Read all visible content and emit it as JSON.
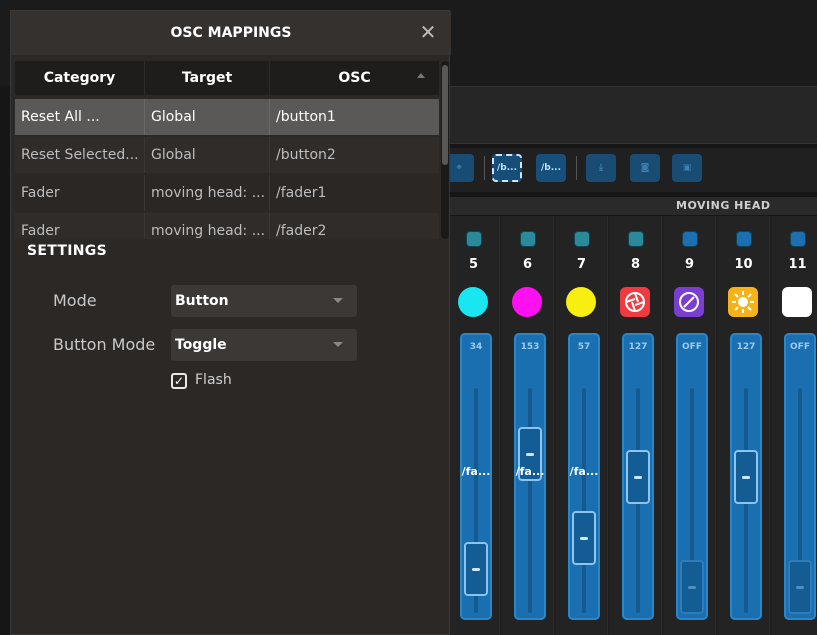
{
  "dialog": {
    "title": "OSC MAPPINGS",
    "close_glyph": "✕"
  },
  "table": {
    "headers": [
      "Category",
      "Target",
      "OSC"
    ],
    "rows": [
      {
        "category": "Reset All ...",
        "target": "Global",
        "osc": "/button1",
        "selected": true
      },
      {
        "category": "Reset Selected...",
        "target": "Global",
        "osc": "/button2",
        "selected": false
      },
      {
        "category": "Fader",
        "target": "moving head: ...",
        "osc": "/fader1",
        "selected": false
      },
      {
        "category": "Fader",
        "target": "moving head: ...",
        "osc": "/fader2",
        "selected": false
      }
    ]
  },
  "settings": {
    "title": "SETTINGS",
    "mode_label": "Mode",
    "mode_value": "Button",
    "button_mode_label": "Button Mode",
    "button_mode_value": "Toggle",
    "flash_label": "Flash",
    "flash_checked": true,
    "check_glyph": "✓"
  },
  "toolbar": {
    "buttons": [
      {
        "label": "",
        "icon": "target-icon",
        "state": "dim"
      },
      {
        "label": "/b...",
        "icon": "osc-button-icon",
        "state": "selected"
      },
      {
        "label": "/b...",
        "icon": "osc-button-icon",
        "state": "normal"
      },
      {
        "label": "",
        "icon": "download-icon",
        "state": "dim"
      },
      {
        "label": "",
        "icon": "camera-icon",
        "state": "dim"
      },
      {
        "label": "",
        "icon": "fixture-icon",
        "state": "dim"
      }
    ]
  },
  "mixer": {
    "group_label": "MOVING HEAD",
    "channels": [
      {
        "number": "5",
        "color": "#19e6f0",
        "icon": "color-dot-icon",
        "value": "34",
        "osc": "/fa...",
        "knob_level": 0.08
      },
      {
        "number": "6",
        "color": "#ff10f0",
        "icon": "color-dot-icon",
        "value": "153",
        "osc": "/fa...",
        "knob_level": 0.6
      },
      {
        "number": "7",
        "color": "#f8ee10",
        "icon": "color-dot-icon",
        "value": "57",
        "osc": "/fa...",
        "knob_level": 0.22
      },
      {
        "number": "8",
        "color": "#ee3a40",
        "icon": "shutter-icon",
        "value": "127",
        "osc": "",
        "knob_level": 0.5
      },
      {
        "number": "9",
        "color": "#7a3ed0",
        "icon": "rotate-icon",
        "value": "OFF",
        "osc": "",
        "knob_level": 0.0
      },
      {
        "number": "10",
        "color": "#f6b21a",
        "icon": "sun-icon",
        "value": "127",
        "osc": "",
        "knob_level": 0.5
      },
      {
        "number": "11",
        "color": "#ffffff",
        "icon": "white-square-icon",
        "value": "OFF",
        "osc": "",
        "knob_level": 0.0
      }
    ]
  }
}
